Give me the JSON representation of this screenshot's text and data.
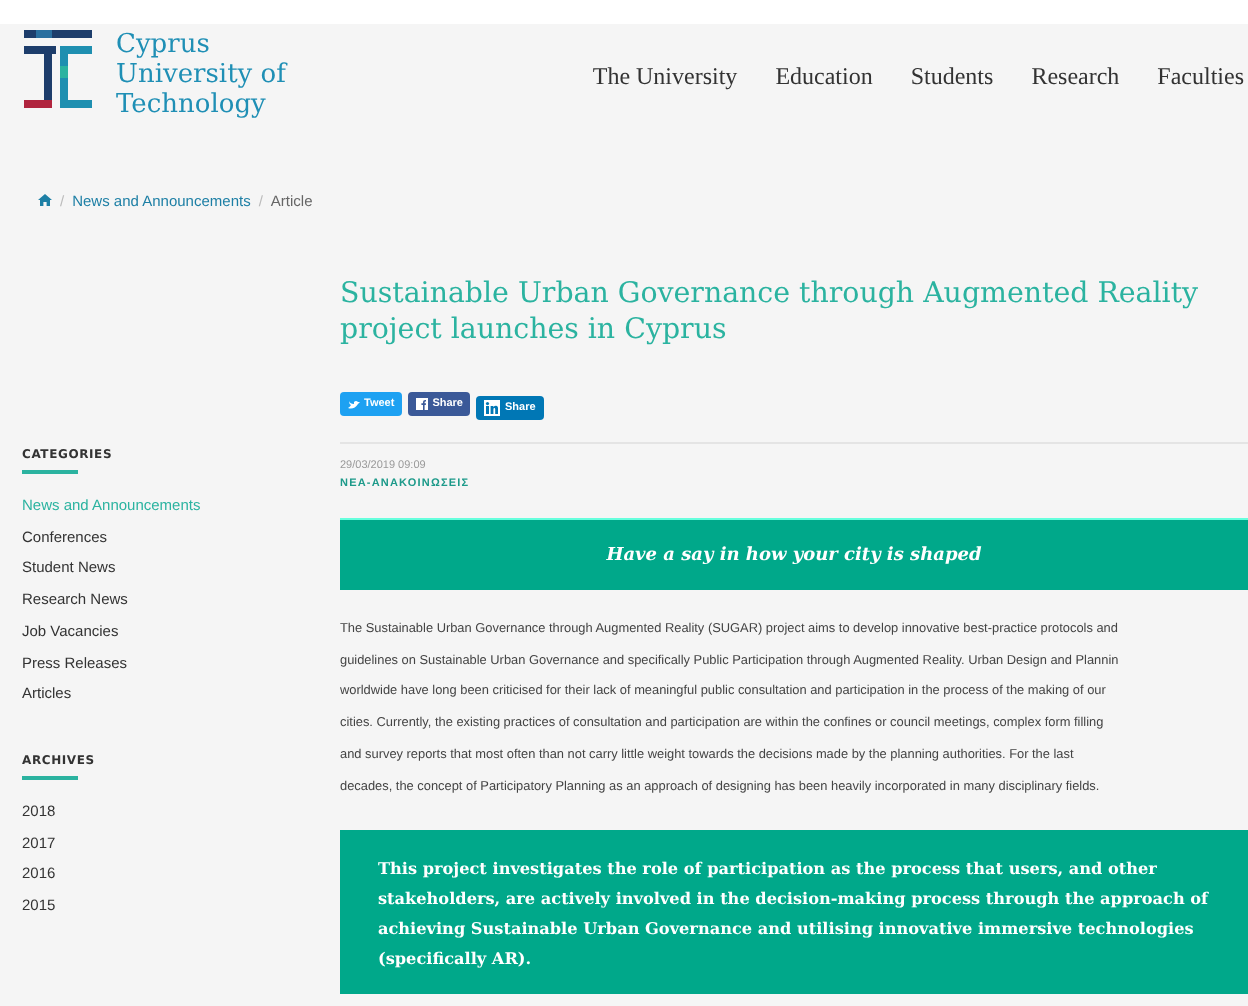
{
  "logo": {
    "name": "Cyprus\nUniversity of\nTechnology"
  },
  "nav": [
    "The University",
    "Education",
    "Students",
    "Research",
    "Faculties"
  ],
  "breadcrumb_separator": "/",
  "breadcrumb": [
    {
      "label": "News and Announcements",
      "kind": "link"
    },
    {
      "label": "Article",
      "kind": "current"
    }
  ],
  "sidebar": {
    "sections": [
      {
        "title": "CATEGORIES",
        "items": [
          {
            "label": "News and Announcements",
            "selected": true
          },
          {
            "label": "Conferences",
            "selected": false
          },
          {
            "label": "Student News",
            "selected": false
          },
          {
            "label": "Research News",
            "selected": false
          },
          {
            "label": "Job Vacancies",
            "selected": false
          },
          {
            "label": "Press Releases",
            "selected": false
          },
          {
            "label": "Articles",
            "selected": false
          }
        ]
      },
      {
        "title": "ARCHIVES",
        "items": [
          {
            "label": "2018",
            "selected": false
          },
          {
            "label": "2017",
            "selected": false
          },
          {
            "label": "2016",
            "selected": false
          },
          {
            "label": "2015",
            "selected": false
          }
        ]
      }
    ]
  },
  "article": {
    "title": "Sustainable Urban Governance through Augmented Reality\nproject launches in Cyprus",
    "share": [
      {
        "kind": "twitter",
        "label": "Tweet"
      },
      {
        "kind": "facebook",
        "label": "Share"
      },
      {
        "kind": "linkedin",
        "label": "Share"
      }
    ],
    "date": "29/03/2019 09:09",
    "category": "ΝΕΑ-ΑΝΑΚΟΙΝΩΣΕΙΣ",
    "banner": "Have a say in how your city is shaped",
    "paragraph": "The Sustainable Urban Governance through Augmented Reality (SUGAR) project aims to develop innovative best-practice protocols and\nguidelines on Sustainable Urban Governance and specifically Public Participation through Augmented Reality. Urban Design and Plannin\nworldwide have long been criticised for their lack of meaningful public consultation and participation in the process of the making of our\ncities. Currently, the existing practices of consultation and participation are within the confines or council meetings, complex form filling\nand survey reports that most often than not carry little weight towards the decisions made by the planning authorities. For the last\ndecades, the concept of Participatory Planning as an approach of designing has been heavily incorporated in many disciplinary fields.",
    "quote": "This project investigates the role of participation as the process that users, and other\nstakeholders, are actively involved in the decision-making process through the approach of\nachieving Sustainable Urban Governance and utilising innovative immersive technologies\n(specifically AR)."
  }
}
